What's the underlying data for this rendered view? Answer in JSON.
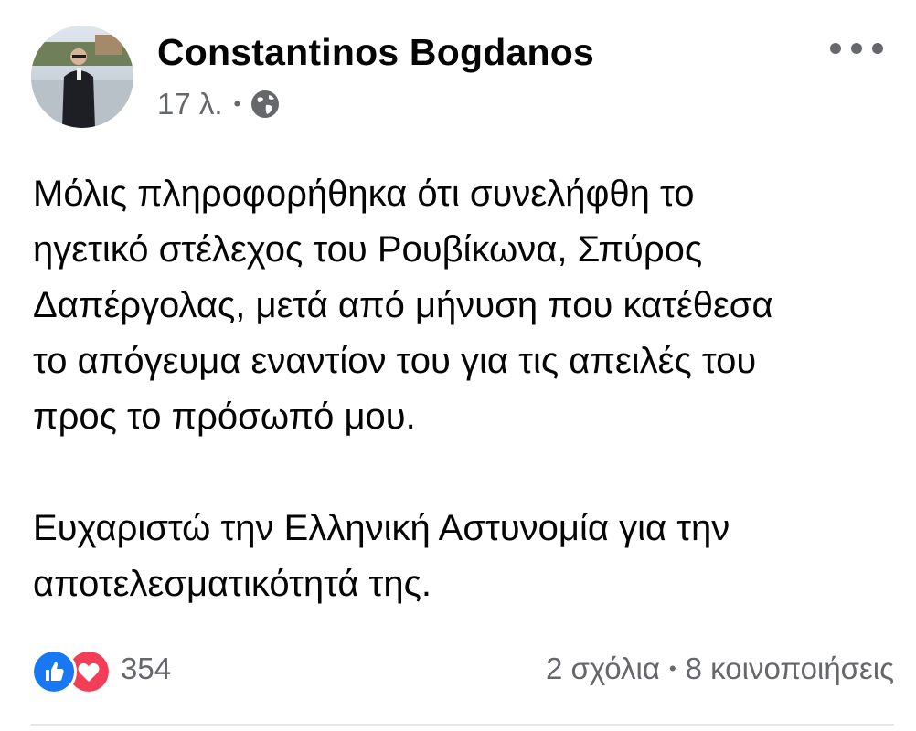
{
  "post": {
    "author": {
      "name": "Constantinos Bogdanos",
      "avatar_icon": "profile-photo"
    },
    "meta": {
      "time": "17 λ.",
      "separator": "•",
      "audience_icon": "globe-icon"
    },
    "more_icon": "more-options-icon",
    "text": {
      "paragraph_1": "Μόλις πληροφορήθηκα ότι συνελήφθη το\nηγετικό στέλεχος του Ρουβίκωνα, Σπύρος\nΔαπέργολας, μετά από μήνυση που κατέθεσα\nτο απόγευμα εναντίον του για τις απειλές του\nπρος το πρόσωπό μου.",
      "paragraph_2": "Ευχαριστώ την Ελληνική Αστυνομία για την\nαποτελεσματικότητά της."
    },
    "footer": {
      "reactions": {
        "icons": [
          "like-icon",
          "love-icon"
        ],
        "count": "354"
      },
      "comments": "2 σχόλια",
      "separator": "•",
      "shares": "8 κοινοποιήσεις"
    },
    "colors": {
      "like": "#1877f2",
      "love": "#f33e58",
      "secondary_text": "#65676b"
    }
  }
}
